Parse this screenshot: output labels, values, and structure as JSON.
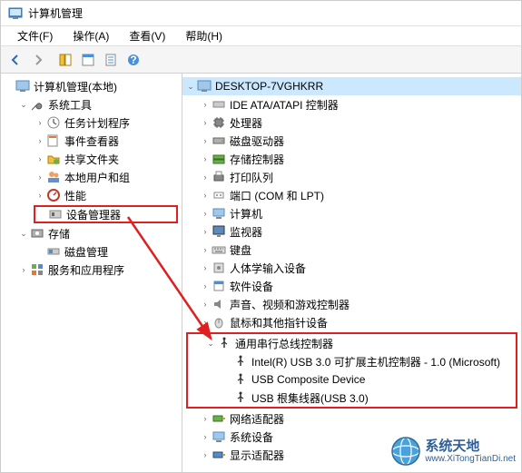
{
  "window": {
    "title": "计算机管理"
  },
  "menubar": {
    "file": "文件(F)",
    "action": "操作(A)",
    "view": "查看(V)",
    "help": "帮助(H)"
  },
  "left_tree": {
    "root": "计算机管理(本地)",
    "system_tools": "系统工具",
    "task_scheduler": "任务计划程序",
    "event_viewer": "事件查看器",
    "shared_folders": "共享文件夹",
    "local_users": "本地用户和组",
    "performance": "性能",
    "device_manager": "设备管理器",
    "storage": "存储",
    "disk_mgmt": "磁盘管理",
    "services_apps": "服务和应用程序"
  },
  "right_tree": {
    "computer": "DESKTOP-7VGHKRR",
    "ide": "IDE ATA/ATAPI 控制器",
    "cpu": "处理器",
    "disk_drive": "磁盘驱动器",
    "storage_ctrl": "存储控制器",
    "print_queue": "打印队列",
    "ports": "端口 (COM 和 LPT)",
    "computers": "计算机",
    "monitors": "监视器",
    "keyboards": "键盘",
    "hid": "人体学输入设备",
    "software": "软件设备",
    "sound": "声音、视频和游戏控制器",
    "mouse": "鼠标和其他指针设备",
    "usb_controllers": "通用串行总线控制器",
    "usb_intel": "Intel(R) USB 3.0 可扩展主机控制器 - 1.0 (Microsoft)",
    "usb_composite": "USB Composite Device",
    "usb_root_hub": "USB 根集线器(USB 3.0)",
    "net_adapters": "网络适配器",
    "system_devices": "系统设备",
    "display_adapters": "显示适配器"
  },
  "watermark": {
    "cn": "系统天地",
    "url": "www.XiTongTianDi.net"
  }
}
